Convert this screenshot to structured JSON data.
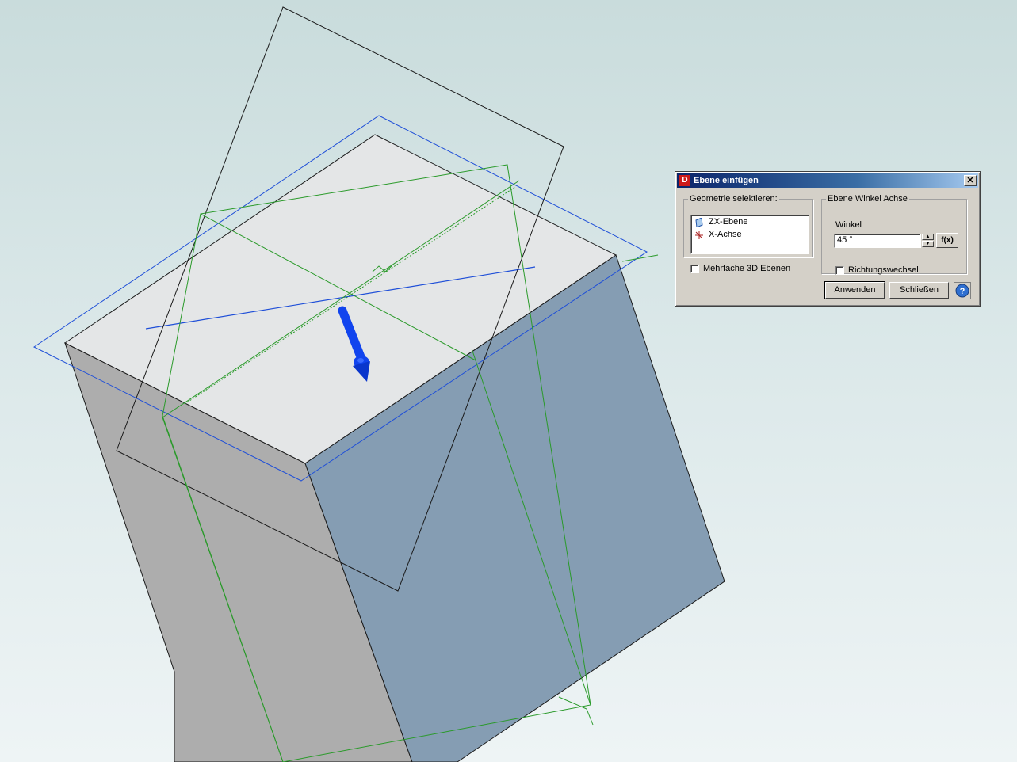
{
  "dialog": {
    "title": "Ebene einfügen",
    "logo_letter": "D",
    "close_label": "✕",
    "geometry_group": {
      "legend": "Geometrie selektieren:",
      "items": [
        {
          "label": "ZX-Ebene",
          "icon": "plane-icon"
        },
        {
          "label": "X-Achse",
          "icon": "axis-icon"
        }
      ]
    },
    "multiple_planes_label": "Mehrfache 3D Ebenen",
    "angle_group": {
      "legend": "Ebene Winkel Achse",
      "angle_label": "Winkel",
      "angle_value": "45 °",
      "function_label": "f(x)",
      "direction_label": "Richtungswechsel"
    },
    "apply_label": "Anwenden",
    "close_button_label": "Schließen",
    "help_label": "?"
  },
  "colors": {
    "box_top": "#e4e6e7",
    "box_left": "#adadad",
    "box_right": "#859db3",
    "plane_blue": "#1f4fd8",
    "plane_green": "#2a9a2a",
    "arrow_blue": "#1144ee",
    "title_start": "#0a246a",
    "title_end": "#a6caf0",
    "dialog_face": "#d4d0c8"
  }
}
